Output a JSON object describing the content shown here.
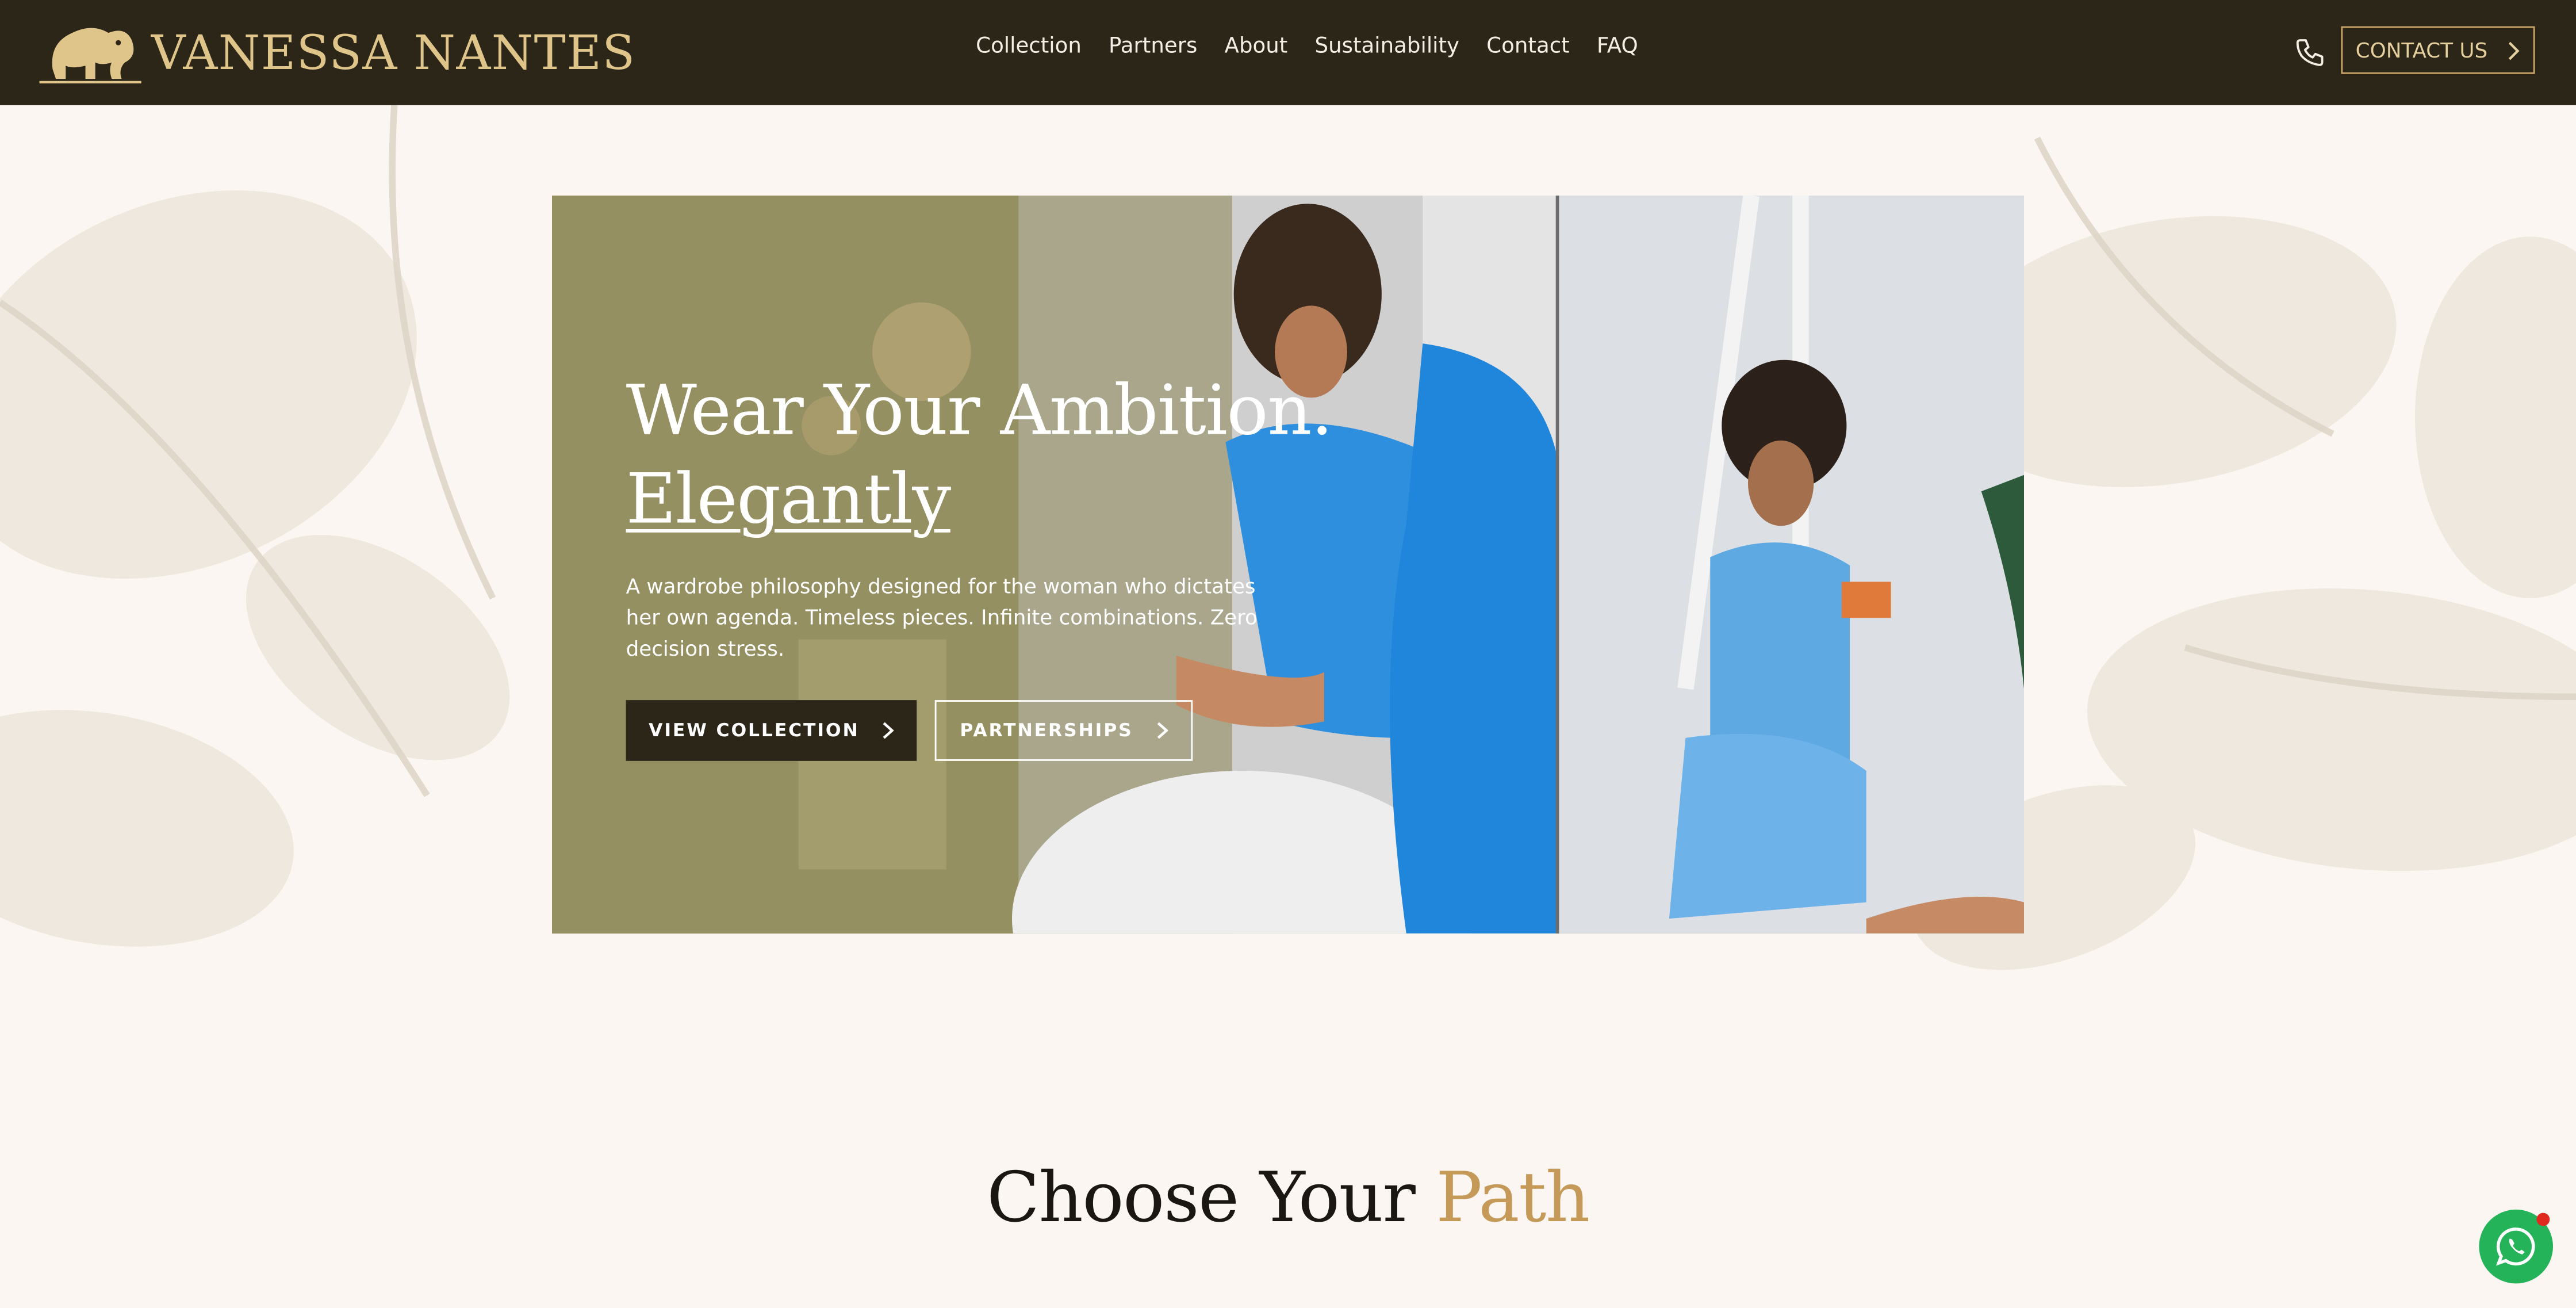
{
  "brand": {
    "name": "VANESSA NANTES",
    "logo_icon": "elephant-icon"
  },
  "nav": {
    "items": [
      {
        "label": "Collection"
      },
      {
        "label": "Partners"
      },
      {
        "label": "About"
      },
      {
        "label": "Sustainability"
      },
      {
        "label": "Contact"
      },
      {
        "label": "FAQ"
      }
    ]
  },
  "header": {
    "phone_icon": "phone-icon",
    "contact_label": "CONTACT US"
  },
  "hero": {
    "title_line1": "Wear Your Ambition.",
    "title_line2": "Elegantly",
    "subtitle": "A wardrobe philosophy designed for the woman who dictates her own agenda. Timeless pieces. Infinite combinations. Zero decision stress.",
    "primary_button": "VIEW COLLECTION",
    "secondary_button": "PARTNERSHIPS"
  },
  "section": {
    "title_main": "Choose Your ",
    "title_accent": "Path"
  },
  "colors": {
    "header_bg": "#2c2619",
    "gold": "#c59a58",
    "page_bg": "#fbf6f1",
    "whatsapp": "#25b35a"
  },
  "floating": {
    "whatsapp_icon": "whatsapp-icon"
  }
}
